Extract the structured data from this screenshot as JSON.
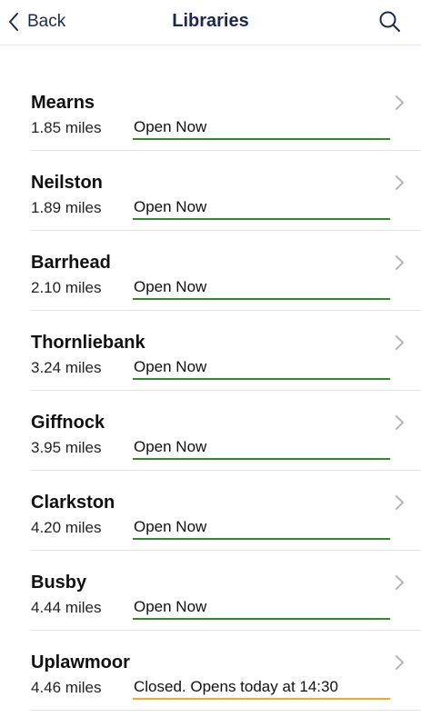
{
  "navbar": {
    "back_label": "Back",
    "title": "Libraries",
    "search_icon": "search-icon",
    "back_icon": "chevron-left-icon"
  },
  "colors": {
    "open": "#2e8b2e",
    "closed": "#f5a623",
    "nav_text": "#1b2a4a"
  },
  "libraries": [
    {
      "name": "Mearns",
      "distance": "1.85 miles",
      "status": "Open Now",
      "open": true
    },
    {
      "name": "Neilston",
      "distance": "1.89 miles",
      "status": "Open Now",
      "open": true
    },
    {
      "name": "Barrhead",
      "distance": "2.10 miles",
      "status": "Open Now",
      "open": true
    },
    {
      "name": "Thornliebank",
      "distance": "3.24 miles",
      "status": "Open Now",
      "open": true
    },
    {
      "name": "Giffnock",
      "distance": "3.95 miles",
      "status": "Open Now",
      "open": true
    },
    {
      "name": "Clarkston",
      "distance": "4.20 miles",
      "status": "Open Now",
      "open": true
    },
    {
      "name": "Busby",
      "distance": "4.44 miles",
      "status": "Open Now",
      "open": true
    },
    {
      "name": "Uplawmoor",
      "distance": "4.46 miles",
      "status": "Closed. Opens today at 14:30",
      "open": false
    }
  ]
}
